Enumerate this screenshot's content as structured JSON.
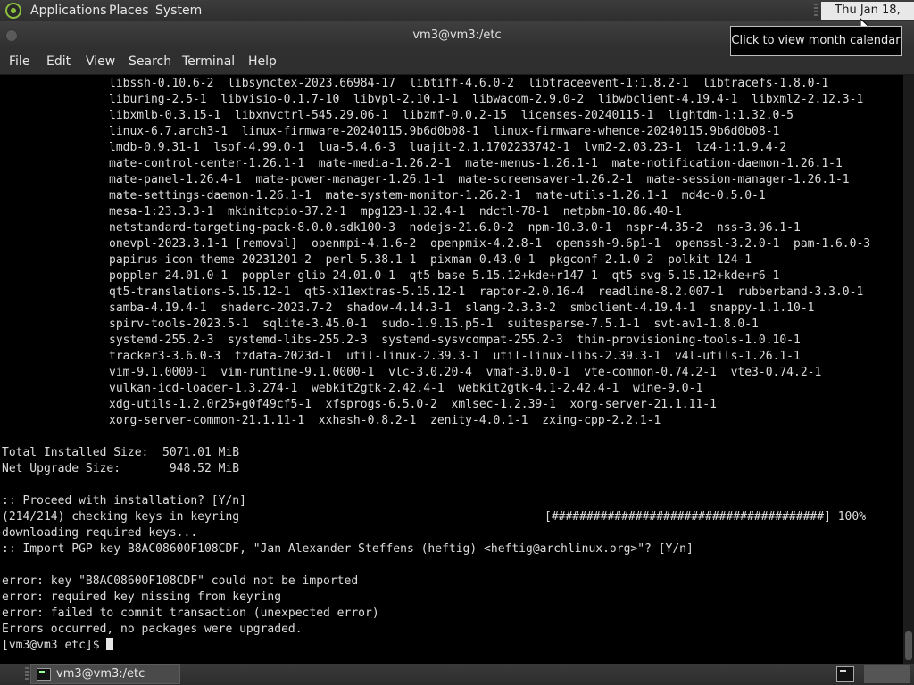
{
  "top_panel": {
    "menus": [
      "Applications",
      "Places",
      "System"
    ],
    "clock": "Thu Jan 18, 17:11",
    "tooltip": "Click to view month calendar"
  },
  "window": {
    "title": "vm3@vm3:/etc",
    "menu": [
      "File",
      "Edit",
      "View",
      "Search",
      "Terminal",
      "Help"
    ]
  },
  "terminal": {
    "package_lines": [
      "libssh-0.10.6-2  libsynctex-2023.66984-17  libtiff-4.6.0-2  libtraceevent-1:1.8.2-1  libtracefs-1.8.0-1",
      "liburing-2.5-1  libvisio-0.1.7-10  libvpl-2.10.1-1  libwacom-2.9.0-2  libwbclient-4.19.4-1  libxml2-2.12.3-1",
      "libxmlb-0.3.15-1  libxnvctrl-545.29.06-1  libzmf-0.0.2-15  licenses-20240115-1  lightdm-1:1.32.0-5",
      "linux-6.7.arch3-1  linux-firmware-20240115.9b6d0b08-1  linux-firmware-whence-20240115.9b6d0b08-1",
      "lmdb-0.9.31-1  lsof-4.99.0-1  lua-5.4.6-3  luajit-2.1.1702233742-1  lvm2-2.03.23-1  lz4-1:1.9.4-2",
      "mate-control-center-1.26.1-1  mate-media-1.26.2-1  mate-menus-1.26.1-1  mate-notification-daemon-1.26.1-1",
      "mate-panel-1.26.4-1  mate-power-manager-1.26.1-1  mate-screensaver-1.26.2-1  mate-session-manager-1.26.1-1",
      "mate-settings-daemon-1.26.1-1  mate-system-monitor-1.26.2-1  mate-utils-1.26.1-1  md4c-0.5.0-1",
      "mesa-1:23.3.3-1  mkinitcpio-37.2-1  mpg123-1.32.4-1  ndctl-78-1  netpbm-10.86.40-1",
      "netstandard-targeting-pack-8.0.0.sdk100-3  nodejs-21.6.0-2  npm-10.3.0-1  nspr-4.35-2  nss-3.96.1-1",
      "onevpl-2023.3.1-1 [removal]  openmpi-4.1.6-2  openpmix-4.2.8-1  openssh-9.6p1-1  openssl-3.2.0-1  pam-1.6.0-3",
      "papirus-icon-theme-20231201-2  perl-5.38.1-1  pixman-0.43.0-1  pkgconf-2.1.0-2  polkit-124-1",
      "poppler-24.01.0-1  poppler-glib-24.01.0-1  qt5-base-5.15.12+kde+r147-1  qt5-svg-5.15.12+kde+r6-1",
      "qt5-translations-5.15.12-1  qt5-x11extras-5.15.12-1  raptor-2.0.16-4  readline-8.2.007-1  rubberband-3.3.0-1",
      "samba-4.19.4-1  shaderc-2023.7-2  shadow-4.14.3-1  slang-2.3.3-2  smbclient-4.19.4-1  snappy-1.1.10-1",
      "spirv-tools-2023.5-1  sqlite-3.45.0-1  sudo-1.9.15.p5-1  suitesparse-7.5.1-1  svt-av1-1.8.0-1",
      "systemd-255.2-3  systemd-libs-255.2-3  systemd-sysvcompat-255.2-3  thin-provisioning-tools-1.0.10-1",
      "tracker3-3.6.0-3  tzdata-2023d-1  util-linux-2.39.3-1  util-linux-libs-2.39.3-1  v4l-utils-1.26.1-1",
      "vim-9.1.0000-1  vim-runtime-9.1.0000-1  vlc-3.0.20-4  vmaf-3.0.0-1  vte-common-0.74.2-1  vte3-0.74.2-1",
      "vulkan-icd-loader-1.3.274-1  webkit2gtk-2.42.4-1  webkit2gtk-4.1-2.42.4-1  wine-9.0-1",
      "xdg-utils-1.2.0r25+g0f49cf5-1  xfsprogs-6.5.0-2  xmlsec-1.2.39-1  xorg-server-21.1.11-1",
      "xorg-server-common-21.1.11-1  xxhash-0.8.2-1  zenity-4.0.1-1  zxing-cpp-2.2.1-1"
    ],
    "total_installed": "Total Installed Size:  5071.01 MiB",
    "net_upgrade": "Net Upgrade Size:       948.52 MiB",
    "proceed": ":: Proceed with installation? [Y/n]",
    "checking_keys": "(214/214) checking keys in keyring",
    "progress_bar": "[#######################################] 100%",
    "downloading": "downloading required keys...",
    "import_pgp": ":: Import PGP key B8AC08600F108CDF, \"Jan Alexander Steffens (heftig) <heftig@archlinux.org>\"? [Y/n]",
    "error1": "error: key \"B8AC08600F108CDF\" could not be imported",
    "error2": "error: required key missing from keyring",
    "error3": "error: failed to commit transaction (unexpected error)",
    "errors_occurred": "Errors occurred, no packages were upgraded.",
    "prompt": "[vm3@vm3 etc]$ "
  },
  "bottom_panel": {
    "task_label": "vm3@vm3:/etc"
  }
}
